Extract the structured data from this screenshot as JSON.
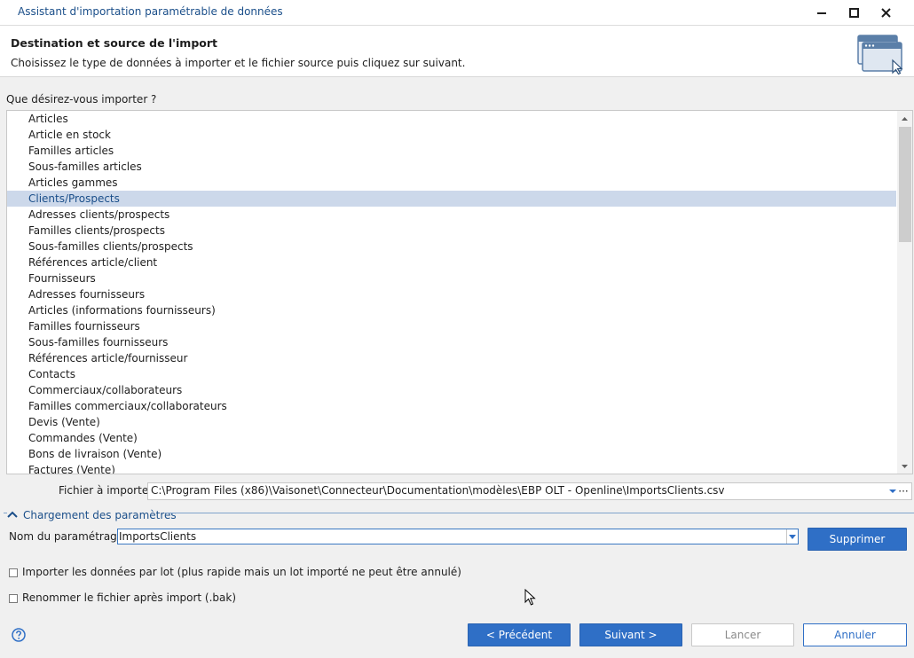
{
  "window": {
    "title": "Assistant d'importation paramétrable de données"
  },
  "header": {
    "title": "Destination et source de l'import",
    "subtitle": "Choisissez le type de données à importer et le fichier source puis cliquez sur suivant."
  },
  "import_list": {
    "label": "Que désirez-vous importer ?",
    "selected_index": 5,
    "items": [
      "Articles",
      "Article en stock",
      "Familles articles",
      "Sous-familles articles",
      "Articles gammes",
      "Clients/Prospects",
      "Adresses clients/prospects",
      "Familles clients/prospects",
      "Sous-familles clients/prospects",
      "Références article/client",
      "Fournisseurs",
      "Adresses fournisseurs",
      "Articles (informations fournisseurs)",
      "Familles fournisseurs",
      "Sous-familles fournisseurs",
      "Références article/fournisseur",
      "Contacts",
      "Commerciaux/collaborateurs",
      "Familles commerciaux/collaborateurs",
      "Devis (Vente)",
      "Commandes (Vente)",
      "Bons de livraison (Vente)",
      "Factures (Vente)"
    ]
  },
  "file": {
    "label": "Fichier à importer",
    "value": "C:\\Program Files (x86)\\Vaisonet\\Connecteur\\Documentation\\modèles\\EBP OLT - Openline\\ImportsClients.csv",
    "more": "···"
  },
  "params": {
    "section_title": "Chargement des paramètres",
    "name_label": "Nom du paramétrage",
    "name_value": "ImportsClients",
    "delete_label": "Supprimer"
  },
  "options": {
    "batch_label": "Importer les données par lot (plus rapide mais un lot importé ne peut être annulé)",
    "rename_label": "Renommer le fichier après import (.bak)"
  },
  "footer": {
    "prev_label": "< Précédent",
    "next_label": "Suivant >",
    "launch_label": "Lancer",
    "cancel_label": "Annuler"
  },
  "colors": {
    "accent": "#2f6fc6",
    "selection": "#ccd8ea",
    "title_text": "#1b4f8a"
  }
}
